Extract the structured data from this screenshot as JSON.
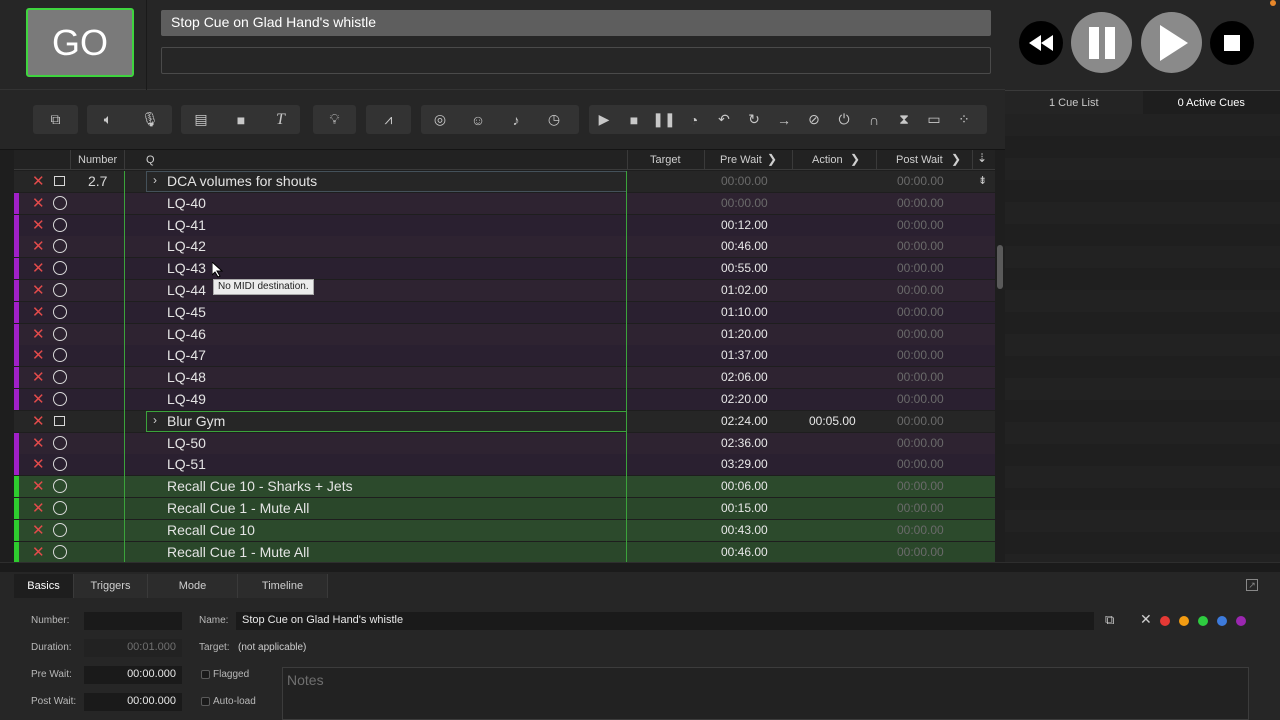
{
  "go": {
    "label": "GO"
  },
  "standby": {
    "name": "Stop Cue on Glad Hand's whistle",
    "notes": ""
  },
  "side_tabs": {
    "cue_lists": "1 Cue List",
    "active_cues": "0 Active Cues"
  },
  "columns": {
    "number": "Number",
    "q": "Q",
    "target": "Target",
    "pre_wait": "Pre Wait",
    "action": "Action",
    "post_wait": "Post Wait"
  },
  "tooltip": "No MIDI destination.",
  "rows": [
    {
      "kind": "group",
      "number": "2.7",
      "name": "DCA volumes for shouts",
      "pre_wait": "00:00.00",
      "action": "",
      "post_wait": "00:00.00"
    },
    {
      "kind": "purple",
      "number": "",
      "name": "LQ-40",
      "pre_wait": "00:00.00",
      "action": "",
      "post_wait": "00:00.00"
    },
    {
      "kind": "purple",
      "number": "",
      "name": "LQ-41",
      "pre_wait": "00:12.00",
      "action": "",
      "post_wait": "00:00.00"
    },
    {
      "kind": "purple",
      "number": "",
      "name": "LQ-42",
      "pre_wait": "00:46.00",
      "action": "",
      "post_wait": "00:00.00"
    },
    {
      "kind": "purple",
      "number": "",
      "name": "LQ-43",
      "pre_wait": "00:55.00",
      "action": "",
      "post_wait": "00:00.00"
    },
    {
      "kind": "purple",
      "number": "",
      "name": "LQ-44",
      "pre_wait": "01:02.00",
      "action": "",
      "post_wait": "00:00.00"
    },
    {
      "kind": "purple",
      "number": "",
      "name": "LQ-45",
      "pre_wait": "01:10.00",
      "action": "",
      "post_wait": "00:00.00"
    },
    {
      "kind": "purple",
      "number": "",
      "name": "LQ-46",
      "pre_wait": "01:20.00",
      "action": "",
      "post_wait": "00:00.00"
    },
    {
      "kind": "purple",
      "number": "",
      "name": "LQ-47",
      "pre_wait": "01:37.00",
      "action": "",
      "post_wait": "00:00.00"
    },
    {
      "kind": "purple",
      "number": "",
      "name": "LQ-48",
      "pre_wait": "02:06.00",
      "action": "",
      "post_wait": "00:00.00"
    },
    {
      "kind": "purple",
      "number": "",
      "name": "LQ-49",
      "pre_wait": "02:20.00",
      "action": "",
      "post_wait": "00:00.00"
    },
    {
      "kind": "group",
      "number": "",
      "name": "Blur Gym",
      "pre_wait": "02:24.00",
      "action": "00:05.00",
      "post_wait": "00:00.00"
    },
    {
      "kind": "purple",
      "number": "",
      "name": "LQ-50",
      "pre_wait": "02:36.00",
      "action": "",
      "post_wait": "00:00.00"
    },
    {
      "kind": "purple",
      "number": "",
      "name": "LQ-51",
      "pre_wait": "03:29.00",
      "action": "",
      "post_wait": "00:00.00"
    },
    {
      "kind": "green",
      "number": "",
      "name": "Recall Cue 10 - Sharks + Jets",
      "pre_wait": "00:06.00",
      "action": "",
      "post_wait": "00:00.00"
    },
    {
      "kind": "green",
      "number": "",
      "name": "Recall Cue 1 - Mute All",
      "pre_wait": "00:15.00",
      "action": "",
      "post_wait": "00:00.00"
    },
    {
      "kind": "green",
      "number": "",
      "name": "Recall Cue 10",
      "pre_wait": "00:43.00",
      "action": "",
      "post_wait": "00:00.00"
    },
    {
      "kind": "green",
      "number": "",
      "name": "Recall Cue 1 - Mute All",
      "pre_wait": "00:46.00",
      "action": "",
      "post_wait": "00:00.00"
    }
  ],
  "inspector": {
    "tabs": [
      "Basics",
      "Triggers",
      "Mode",
      "Timeline"
    ],
    "number_label": "Number:",
    "number_value": "",
    "name_label": "Name:",
    "name_value": "Stop Cue on Glad Hand's whistle",
    "duration_label": "Duration:",
    "duration_value": "00:01.000",
    "target_label": "Target:",
    "target_value": "(not applicable)",
    "prewait_label": "Pre Wait:",
    "prewait_value": "00:00.000",
    "postwait_label": "Post Wait:",
    "postwait_value": "00:00.000",
    "flagged_label": "Flagged",
    "autoload_label": "Auto-load",
    "notes_placeholder": "Notes"
  },
  "colors": {
    "go_border": "#3fd43f",
    "purple_stripe": "#a020c8",
    "green_stripe": "#2ecc2e",
    "delete_x": "#e24b4b",
    "swatches": [
      "#e53935",
      "#f39c12",
      "#2ecc40",
      "#3d7bdc",
      "#9b27b0"
    ]
  }
}
